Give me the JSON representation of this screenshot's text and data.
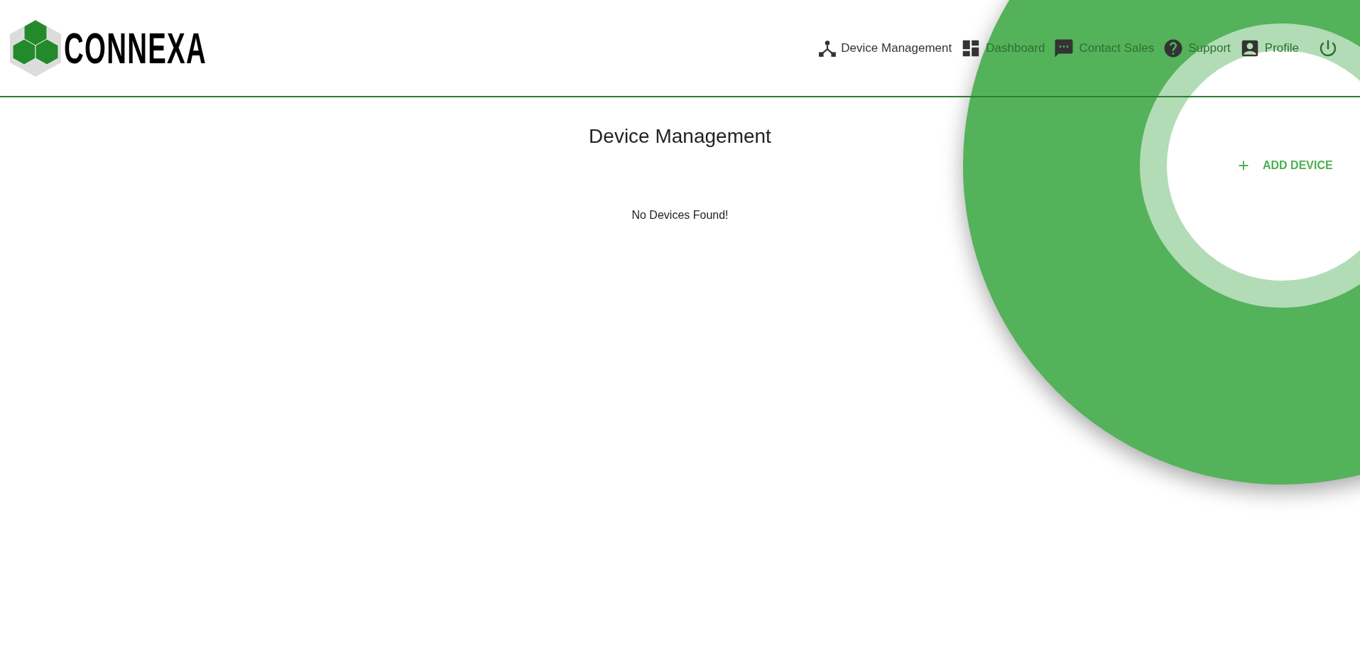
{
  "logo": {
    "text": "CONNEXA"
  },
  "nav": [
    {
      "label": "Device Management"
    },
    {
      "label": "Dashboard"
    },
    {
      "label": "Contact Sales"
    },
    {
      "label": "Support"
    },
    {
      "label": "Profile"
    }
  ],
  "page": {
    "title": "Device Management",
    "empty_message": "No Devices Found!"
  },
  "spotlight": {
    "button": {
      "label": "ADD DEVICE"
    }
  }
}
